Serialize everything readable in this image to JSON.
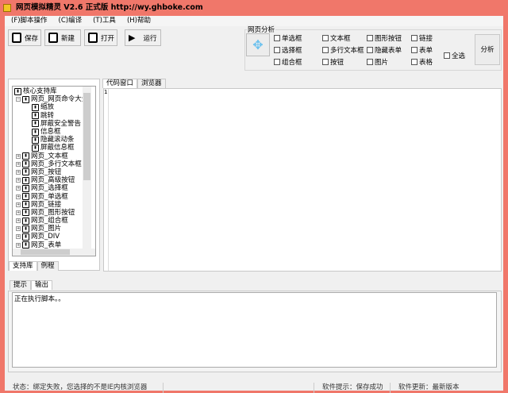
{
  "title": "网页模拟精灵  V2.6 正式版  http://wy.ghboke.com",
  "menu": [
    "(F)脚本操作",
    "(C)编译",
    "(T)工具",
    "(H)帮助"
  ],
  "toolbar": {
    "save": "保存",
    "new": "新建",
    "open": "打开",
    "run": "运行"
  },
  "analysis": {
    "label": "网页分析",
    "checkboxes": [
      [
        "单选框",
        "选择框",
        "组合框"
      ],
      [
        "文本框",
        "多行文本框",
        "按钮"
      ],
      [
        "图形按钮",
        "隐藏表单",
        "图片"
      ],
      [
        "链接",
        "表单",
        "表格"
      ]
    ],
    "select_all": "全选",
    "analyze": "分析"
  },
  "tree": {
    "root": "核心支持库",
    "expanded": "网页_网页命令大全",
    "children": [
      "缩放",
      "跳转",
      "屏蔽安全警告",
      "信息框",
      "隐藏滚动条",
      "屏蔽信息框"
    ],
    "items": [
      "网页_文本框",
      "网页_多行文本框",
      "网页_按钮",
      "网页_高级按钮",
      "网页_选择框",
      "网页_单选框",
      "网页_链接",
      "网页_图形按钮",
      "网页_组合框",
      "网页_图片",
      "网页_DIV",
      "网页_表单"
    ]
  },
  "left_tabs": [
    "支持库",
    "例程"
  ],
  "editor_tabs": [
    "代码窗口",
    "浏览器"
  ],
  "editor": {
    "line": "1"
  },
  "output_tabs": [
    "提示",
    "输出"
  ],
  "output": "正在执行脚本。。",
  "status": [
    "状态：绑定失败，您选择的不是IE内核浏览器",
    "",
    "软件提示：保存成功",
    "软件更新：最新版本"
  ]
}
